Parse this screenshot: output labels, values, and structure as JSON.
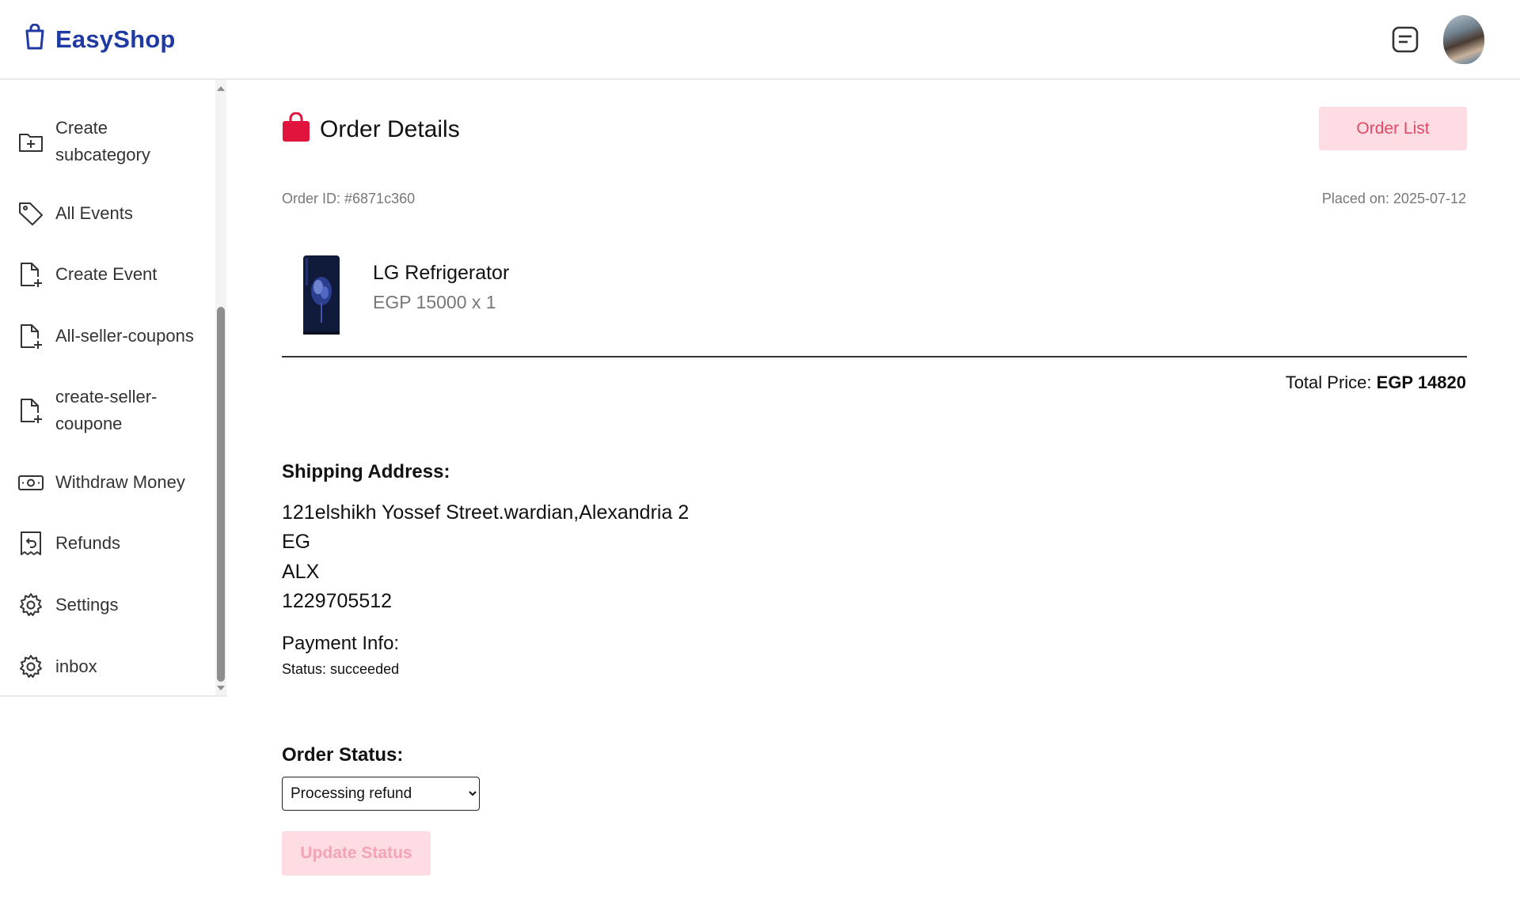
{
  "header": {
    "app_name": "EasyShop",
    "brand_color": "#1f3aa3",
    "icons": [
      "shopping-bag-icon",
      "message-icon",
      "avatar"
    ]
  },
  "sidebar": {
    "items": [
      {
        "label": "Create subcategory",
        "icon": "folder-plus-icon"
      },
      {
        "label": "All Events",
        "icon": "tag-icon"
      },
      {
        "label": "Create Event",
        "icon": "file-plus-icon"
      },
      {
        "label": "All-seller-coupons",
        "icon": "file-plus-icon"
      },
      {
        "label": "create-seller-coupone",
        "icon": "file-plus-icon"
      },
      {
        "label": "Withdraw Money",
        "icon": "money-icon"
      },
      {
        "label": "Refunds",
        "icon": "receipt-refund-icon"
      },
      {
        "label": "Settings",
        "icon": "gear-icon"
      },
      {
        "label": "inbox",
        "icon": "gear-icon"
      }
    ]
  },
  "main": {
    "title": "Order Details",
    "title_icon_color": "#e0143c",
    "order_list_label": "Order List",
    "order_id": "Order ID: #6871c360",
    "placed_on": "Placed on: 2025-07-12",
    "item": {
      "name": "LG Refrigerator",
      "price_line": "EGP 15000 x 1"
    },
    "total_label": "Total Price:",
    "total_value": "EGP 14820",
    "shipping": {
      "title": "Shipping Address:",
      "line1": "121elshikh Yossef Street.wardian,Alexandria 2",
      "line2": "EG",
      "line3": "ALX",
      "line4": "1229705512"
    },
    "payment": {
      "title": "Payment Info:",
      "status": "Status: succeeded"
    },
    "order_status": {
      "title": "Order Status:",
      "selected": "Processing refund"
    },
    "update_label": "Update Status",
    "accent_color": "#e24766",
    "accent_bg": "#fddde3"
  }
}
